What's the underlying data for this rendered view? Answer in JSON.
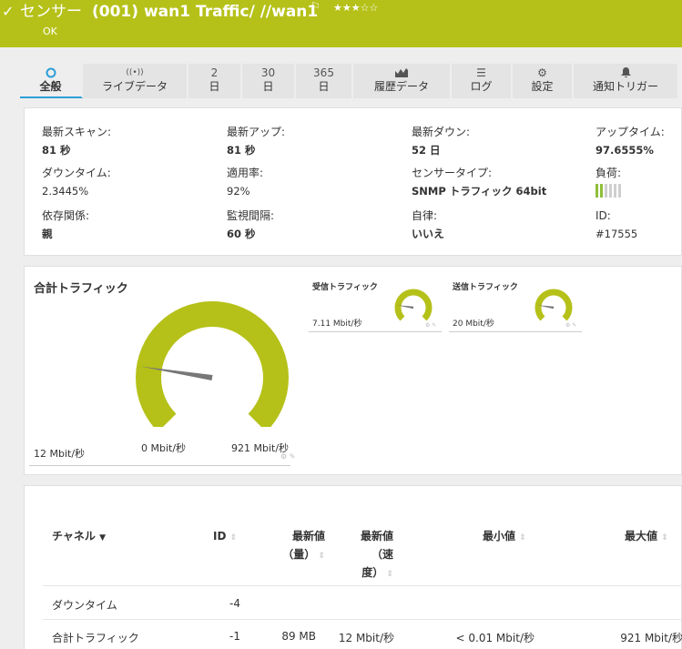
{
  "header": {
    "status_icon": "check-icon",
    "title_prefix": "センサー",
    "title_main": "(001) wan1 Traffic/ //wan1",
    "flag_icon": "flag-icon",
    "stars": "★★★☆☆",
    "priority_stars": 3,
    "status_text": "OK",
    "bg_color": "#b5c118"
  },
  "tabs": [
    {
      "icon": "◔",
      "icon_name": "overview-icon",
      "label": "全般",
      "active": true
    },
    {
      "icon": "((•))",
      "icon_name": "live-data-icon",
      "label": "ライブデータ"
    },
    {
      "icon": "2",
      "icon_name": "",
      "label": "日"
    },
    {
      "icon": "30",
      "icon_name": "",
      "label": "日"
    },
    {
      "icon": "365",
      "icon_name": "",
      "label": "日"
    },
    {
      "icon": "📈",
      "icon_name": "history-chart-icon",
      "label": "履歴データ"
    },
    {
      "icon": "☰",
      "icon_name": "log-icon",
      "label": "ログ"
    },
    {
      "icon": "⚙",
      "icon_name": "settings-icon",
      "label": "設定"
    },
    {
      "icon": "🔔",
      "icon_name": "bell-icon",
      "label": "通知トリガー"
    }
  ],
  "info": {
    "last_scan": {
      "label": "最新スキャン:",
      "value": "81 秒"
    },
    "last_up": {
      "label": "最新アップ:",
      "value": "81 秒"
    },
    "last_down": {
      "label": "最新ダウン:",
      "value": "52 日"
    },
    "uptime": {
      "label": "アップタイム:",
      "value": "97.6555%"
    },
    "downtime": {
      "label": "ダウンタイム:",
      "value": "2.3445%"
    },
    "coverage": {
      "label": "適用率:",
      "value": "92%"
    },
    "sensor_type": {
      "label": "センサータイプ:",
      "value": "SNMP トラフィック 64bit"
    },
    "load": {
      "label": "負荷:",
      "level": 2,
      "max": 6
    },
    "dependency": {
      "label": "依存関係:",
      "value": "親"
    },
    "interval": {
      "label": "監視間隔:",
      "value": "60 秒"
    },
    "autonomous": {
      "label": "自律:",
      "value": "いいえ"
    },
    "id": {
      "label": "ID:",
      "value": "#17555"
    }
  },
  "gauges": {
    "total": {
      "title": "合計トラフィック",
      "value_label": "12 Mbit/秒",
      "min_label": "0 Mbit/秒",
      "max_label": "921 Mbit/秒",
      "value": 12,
      "max": 921
    },
    "in": {
      "title": "受信トラフィック",
      "value_label": "7.11 Mbit/秒",
      "value": 7.11,
      "max": 921
    },
    "out": {
      "title": "送信トラフィック",
      "value_label": "20 Mbit/秒",
      "value": 20,
      "max": 921
    },
    "accent_color": "#b5c118"
  },
  "table": {
    "headers": {
      "channel": "チャネル",
      "id": "ID",
      "last_vol_1": "最新値",
      "last_vol_2": "（量）",
      "last_speed_1": "最新値",
      "last_speed_2": "（速",
      "last_speed_3": "度）",
      "min": "最小値",
      "max": "最大値"
    },
    "rows": [
      {
        "channel": "ダウンタイム",
        "id": "-4",
        "last_vol": "",
        "last_speed": "",
        "min": "",
        "max": ""
      },
      {
        "channel": "合計トラフィック",
        "id": "-1",
        "last_vol": "89 MB",
        "last_speed": "12 Mbit/秒",
        "min": "< 0.01 Mbit/秒",
        "max": "921 Mbit/秒"
      }
    ]
  }
}
